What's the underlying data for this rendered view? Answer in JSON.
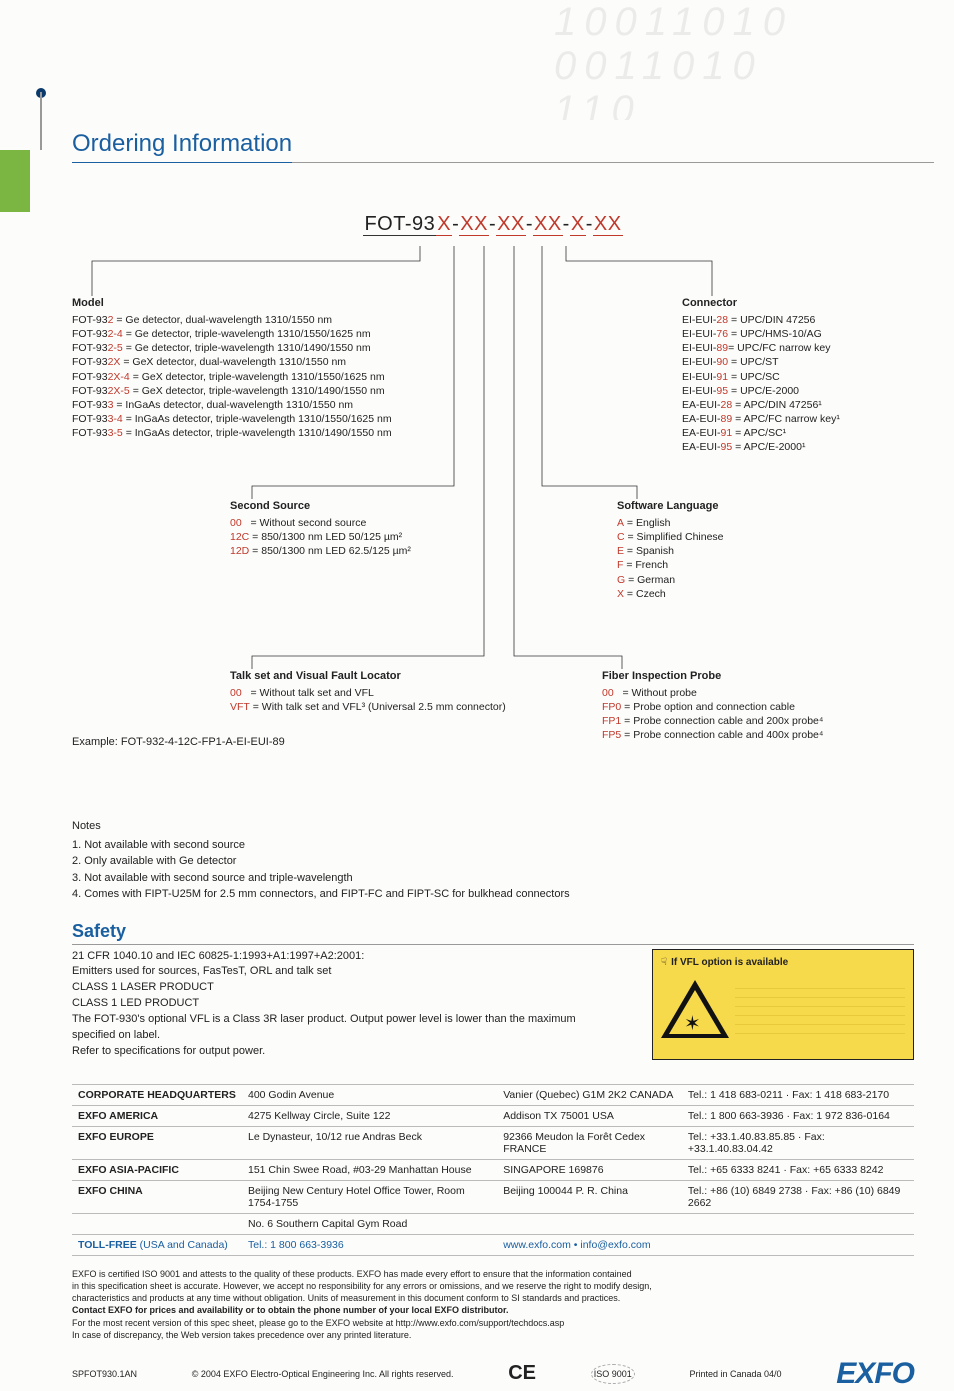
{
  "heading": "Ordering Information",
  "codeLine": {
    "prefix": "FOT-93",
    "x1": "X",
    "sep": "-",
    "xx": "XX",
    "x": "X"
  },
  "groups": {
    "model": {
      "title": "Model",
      "rows": [
        {
          "code": "FOT-932",
          "desc": " = Ge detector, dual-wavelength 1310/1550 nm"
        },
        {
          "code": "FOT-932-4",
          "desc": " = Ge detector, triple-wavelength 1310/1550/1625 nm"
        },
        {
          "code": "FOT-932-5",
          "desc": " = Ge detector, triple-wavelength 1310/1490/1550 nm"
        },
        {
          "code": "FOT-932X",
          "desc": " = GeX detector, dual-wavelength 1310/1550 nm"
        },
        {
          "code": "FOT-932X-4",
          "desc": " = GeX detector, triple-wavelength 1310/1550/1625 nm"
        },
        {
          "code": "FOT-932X-5",
          "desc": " = GeX detector, triple-wavelength 1310/1490/1550 nm"
        },
        {
          "code": "FOT-933",
          "desc": " = InGaAs detector, dual-wavelength 1310/1550 nm"
        },
        {
          "code": "FOT-933-4",
          "desc": " = InGaAs detector, triple-wavelength 1310/1550/1625 nm"
        },
        {
          "code": "FOT-933-5",
          "desc": " = InGaAs detector, triple-wavelength 1310/1490/1550 nm"
        }
      ]
    },
    "connector": {
      "title": "Connector",
      "rows": [
        {
          "code": "EI-EUI-28",
          "desc": " = UPC/DIN 47256"
        },
        {
          "code": "EI-EUI-76",
          "desc": " = UPC/HMS-10/AG"
        },
        {
          "code": "EI-EUI-89",
          "desc": "= UPC/FC narrow key"
        },
        {
          "code": "EI-EUI-90",
          "desc": " = UPC/ST"
        },
        {
          "code": "EI-EUI-91",
          "desc": " = UPC/SC"
        },
        {
          "code": "EI-EUI-95",
          "desc": " = UPC/E-2000"
        },
        {
          "code": "EA-EUI-28",
          "desc": " = APC/DIN 47256¹"
        },
        {
          "code": "EA-EUI-89",
          "desc": " = APC/FC narrow key¹"
        },
        {
          "code": "EA-EUI-91",
          "desc": " = APC/SC¹"
        },
        {
          "code": "EA-EUI-95",
          "desc": " = APC/E-2000¹"
        }
      ]
    },
    "secondSource": {
      "title": "Second Source",
      "rows": [
        {
          "code": "00",
          "desc": "   = Without second source"
        },
        {
          "code": "12C",
          "desc": " = 850/1300 nm LED 50/125 µm²"
        },
        {
          "code": "12D",
          "desc": " = 850/1300 nm LED 62.5/125 µm²"
        }
      ]
    },
    "lang": {
      "title": "Software Language",
      "rows": [
        {
          "code": "A",
          "desc": " = English"
        },
        {
          "code": "C",
          "desc": " = Simplified Chinese"
        },
        {
          "code": "E",
          "desc": " = Spanish"
        },
        {
          "code": "F",
          "desc": " = French"
        },
        {
          "code": "G",
          "desc": " = German"
        },
        {
          "code": "X",
          "desc": " = Czech"
        }
      ]
    },
    "talkset": {
      "title": "Talk set and Visual Fault Locator",
      "rows": [
        {
          "code": "00",
          "desc": "   = Without talk set and VFL"
        },
        {
          "code": "VFT",
          "desc": " = With talk set and VFL³ (Universal 2.5 mm connector)"
        }
      ]
    },
    "probe": {
      "title": "Fiber Inspection Probe",
      "rows": [
        {
          "code": "00",
          "desc": "   = Without probe"
        },
        {
          "code": "FP0",
          "desc": " = Probe option and connection cable"
        },
        {
          "code": "FP1",
          "desc": " = Probe connection cable and 200x probe⁴"
        },
        {
          "code": "FP5",
          "desc": " = Probe connection cable and 400x probe⁴"
        }
      ]
    }
  },
  "example": "Example: FOT-932-4-12C-FP1-A-EI-EUI-89",
  "notesTitle": "Notes",
  "notes": [
    "1. Not available with second source",
    "2. Only available with Ge detector",
    "3. Not available with second source and triple-wavelength",
    "4. Comes with FIPT-U25M for 2.5 mm connectors, and FIPT-FC and FIPT-SC for bulkhead connectors"
  ],
  "safety": {
    "title": "Safety",
    "lines": [
      "21 CFR 1040.10 and IEC 60825-1:1993+A1:1997+A2:2001:",
      "Emitters used for sources, FasTesT, ORL and talk set",
      "CLASS 1 LASER PRODUCT",
      "CLASS 1 LED PRODUCT",
      "The FOT-930's optional VFL is a Class 3R laser product. Output power level is lower than the maximum specified on label.",
      "Refer to specifications for output power."
    ],
    "badge": "If VFL option is available"
  },
  "contacts": [
    {
      "lbl": "CORPORATE HEADQUARTERS",
      "addr": "400 Godin Avenue",
      "city": "Vanier (Quebec)  G1M 2K2 CANADA",
      "tel": "Tel.: 1 418 683-0211 · Fax: 1 418 683-2170"
    },
    {
      "lbl": "EXFO AMERICA",
      "addr": "4275 Kellway Circle, Suite 122",
      "city": "Addison TX 75001 USA",
      "tel": "Tel.: 1 800 663-3936 · Fax: 1 972 836-0164"
    },
    {
      "lbl": "EXFO EUROPE",
      "addr": "Le Dynasteur, 10/12 rue Andras Beck",
      "city": "92366 Meudon la Forêt Cedex FRANCE",
      "tel": "Tel.: +33.1.40.83.85.85 · Fax: +33.1.40.83.04.42"
    },
    {
      "lbl": "EXFO ASIA-PACIFIC",
      "addr": "151 Chin Swee Road, #03-29 Manhattan House",
      "city": "SINGAPORE 169876",
      "tel": "Tel.: +65 6333 8241 · Fax: +65 6333 8242"
    },
    {
      "lbl": "EXFO CHINA",
      "addr": "Beijing New Century Hotel Office Tower, Room 1754-1755",
      "city": "Beijing 100044 P. R. China",
      "tel": "Tel.: +86 (10) 6849 2738 · Fax: +86 (10) 6849 2662"
    },
    {
      "lbl": "",
      "addr": "No. 6 Southern Capital Gym Road",
      "city": "",
      "tel": ""
    }
  ],
  "tollfree": {
    "lbl": "TOLL-FREE",
    "extra": " (USA and Canada)",
    "tel": "Tel.: 1 800 663-3936",
    "web": "www.exfo.com  •  info@exfo.com"
  },
  "fineprint": [
    "EXFO is certified ISO 9001 and attests to the quality of these products. EXFO has made every effort to ensure that the information contained",
    "in this specification sheet is accurate. However, we accept no responsibility for any errors or omissions, and we reserve the right to modify design,",
    "characteristics and products at any time without obligation. Units of measurement in this document conform to SI standards and practices.",
    "Contact EXFO for prices and availability or to obtain the phone number of your local EXFO distributor.",
    "For the most recent version of this spec sheet, please go to the EXFO website at  http://www.exfo.com/support/techdocs.asp",
    "In case of discrepancy, the Web version takes precedence over any printed literature."
  ],
  "footer": {
    "doc": "SPFOT930.1AN",
    "copy": "© 2004 EXFO Electro-Optical Engineering Inc. All rights reserved.",
    "printed": "Printed in Canada 04/0",
    "logo": "EXFO"
  }
}
